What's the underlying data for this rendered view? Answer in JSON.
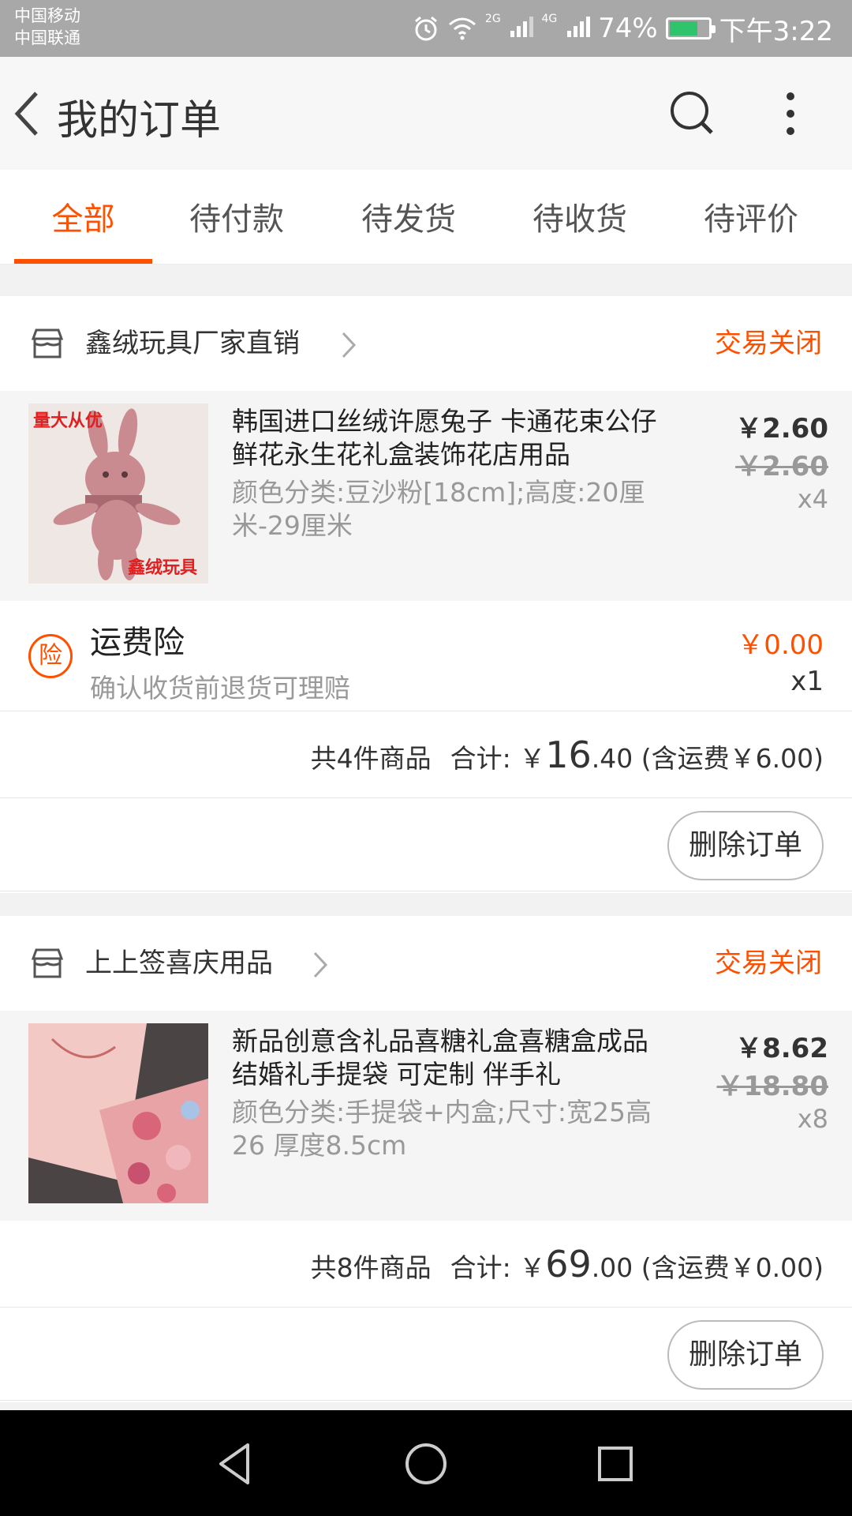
{
  "status_bar": {
    "carrier_1": "中国移动",
    "carrier_2": "中国联通",
    "net_1": "2G",
    "net_2": "4G",
    "battery": "74%",
    "time": "下午3:22"
  },
  "header": {
    "title": "我的订单",
    "icons": [
      "back-arrow-icon",
      "search-icon",
      "more-icon"
    ]
  },
  "tabs": [
    {
      "label": "全部",
      "active": true
    },
    {
      "label": "待付款",
      "active": false
    },
    {
      "label": "待发货",
      "active": false
    },
    {
      "label": "待收货",
      "active": false
    },
    {
      "label": "待评价",
      "active": false
    }
  ],
  "orders": [
    {
      "shop_name": "鑫绒玩具厂家直销",
      "status": "交易关闭",
      "item": {
        "title": "韩国进口丝绒许愿兔子 卡通花束公仔 鲜花永生花礼盒装饰花店用品",
        "spec": "颜色分类:豆沙粉[18cm];高度:20厘米-29厘米",
        "price": "￥2.60",
        "original_price": "￥2.60",
        "quantity": "x4",
        "thumb_text_top": "量大从优",
        "thumb_text_bottom": "鑫绒玩具"
      },
      "insurance": {
        "badge": "险",
        "name": "运费险",
        "desc": "确认收货前退货可理赔",
        "price": "￥0.00",
        "quantity": "x1"
      },
      "summary": {
        "count_text": "共4件商品",
        "total_label": "合计: ￥",
        "total_int": "16",
        "total_dec": ".40",
        "shipping_text": "(含运费￥6.00)"
      },
      "delete_label": "删除订单"
    },
    {
      "shop_name": "上上签喜庆用品",
      "status": "交易关闭",
      "item": {
        "title": "新品创意含礼品喜糖礼盒喜糖盒成品结婚礼手提袋 可定制 伴手礼",
        "spec": "颜色分类:手提袋+内盒;尺寸:宽25高26 厚度8.5cm",
        "price": "￥8.62",
        "original_price": "￥18.80",
        "quantity": "x8"
      },
      "summary": {
        "count_text": "共8件商品",
        "total_label": "合计: ￥",
        "total_int": "69",
        "total_dec": ".00",
        "shipping_text": "(含运费￥0.00)"
      },
      "delete_label": "删除订单"
    }
  ],
  "colors": {
    "accent": "#ff5000",
    "status_bar": "#a8a8a8",
    "page_bg": "#f2f2f2"
  },
  "nav_bar": {
    "icons": [
      "nav-back-icon",
      "nav-home-icon",
      "nav-recents-icon"
    ]
  }
}
